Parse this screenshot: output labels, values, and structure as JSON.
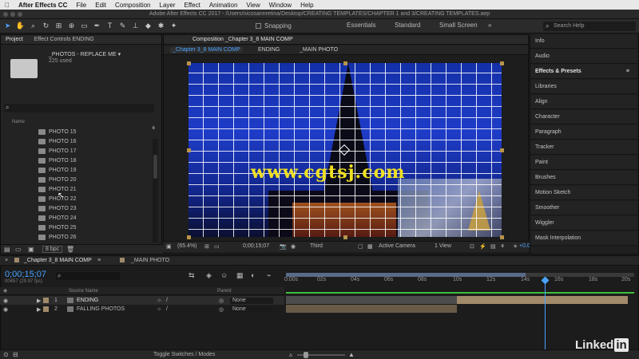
{
  "menubar": {
    "app_name": "After Effects CC",
    "items": [
      "File",
      "Edit",
      "Composition",
      "Layer",
      "Effect",
      "Animation",
      "View",
      "Window",
      "Help"
    ]
  },
  "titlebar": {
    "title": "Adobe After Effects CC 2017 - /Users/nicosannretina/Desktop/CREATING TEMPLATES/CHAPTER 1 and 3/CREATING TEMPLATES.aep"
  },
  "toolbar": {
    "snapping_label": "Snapping",
    "workspaces": [
      "Essentials",
      "Standard",
      "Small Screen"
    ],
    "search_placeholder": "Search Help"
  },
  "project_panel": {
    "tabs": [
      "Project",
      "Effect Controls ENDING"
    ],
    "selected_item_name": "_PHOTOS - REPLACE ME ▾",
    "selected_item_info": "225 used",
    "search_placeholder": "",
    "column_header": "Name",
    "items": [
      "PHOTO 15",
      "PHOTO 16",
      "PHOTO 17",
      "PHOTO 18",
      "PHOTO 19",
      "PHOTO 20",
      "PHOTO 21",
      "PHOTO 22",
      "PHOTO 23",
      "PHOTO 24",
      "PHOTO 25",
      "PHOTO 26"
    ],
    "bpc_label": "8 bpc"
  },
  "composition_panel": {
    "tab_label": "Composition _Chapter 3_8 MAIN COMP",
    "breadcrumbs": [
      "_Chapter 3_8 MAIN COMP",
      "ENDING",
      "_MAIN PHOTO"
    ],
    "watermark": "www.cgtsj.com",
    "footer": {
      "zoom": "(65.4%)",
      "timecode": "0;00;15;07",
      "resolution": "Third",
      "camera": "Active Camera",
      "views": "1 View",
      "exposure": "+0.0"
    }
  },
  "right_panel": {
    "items": [
      "Info",
      "Audio",
      "Effects & Presets",
      "Libraries",
      "Align",
      "Character",
      "Paragraph",
      "Tracker",
      "Paint",
      "Brushes",
      "Motion Sketch",
      "Smoother",
      "Wiggler",
      "Mask Interpolation"
    ]
  },
  "timeline": {
    "tabs": [
      "_Chapter 3_8 MAIN COMP",
      "_MAIN PHOTO"
    ],
    "timecode": "0;00;15;07",
    "frame_info": "00457 (29.97 fps)",
    "columns": {
      "source_name": "Source Name",
      "parent": "Parent"
    },
    "layers": [
      {
        "num": "1",
        "name": "ENDING",
        "parent": "None"
      },
      {
        "num": "2",
        "name": "FALLING PHOTOS",
        "parent": "None"
      }
    ],
    "ruler_labels": [
      "0:00s",
      "02s",
      "04s",
      "06s",
      "08s",
      "10s",
      "12s",
      "14s",
      "16s",
      "18s",
      "20s"
    ],
    "toggle_label": "Toggle Switches / Modes"
  },
  "branding": {
    "linkedin_text": "Linked",
    "linkedin_box": "in"
  },
  "colors": {
    "accent_blue": "#4aa3ff",
    "layer_green": "#3fbf3f",
    "layer_tan": "#a08a6a"
  }
}
